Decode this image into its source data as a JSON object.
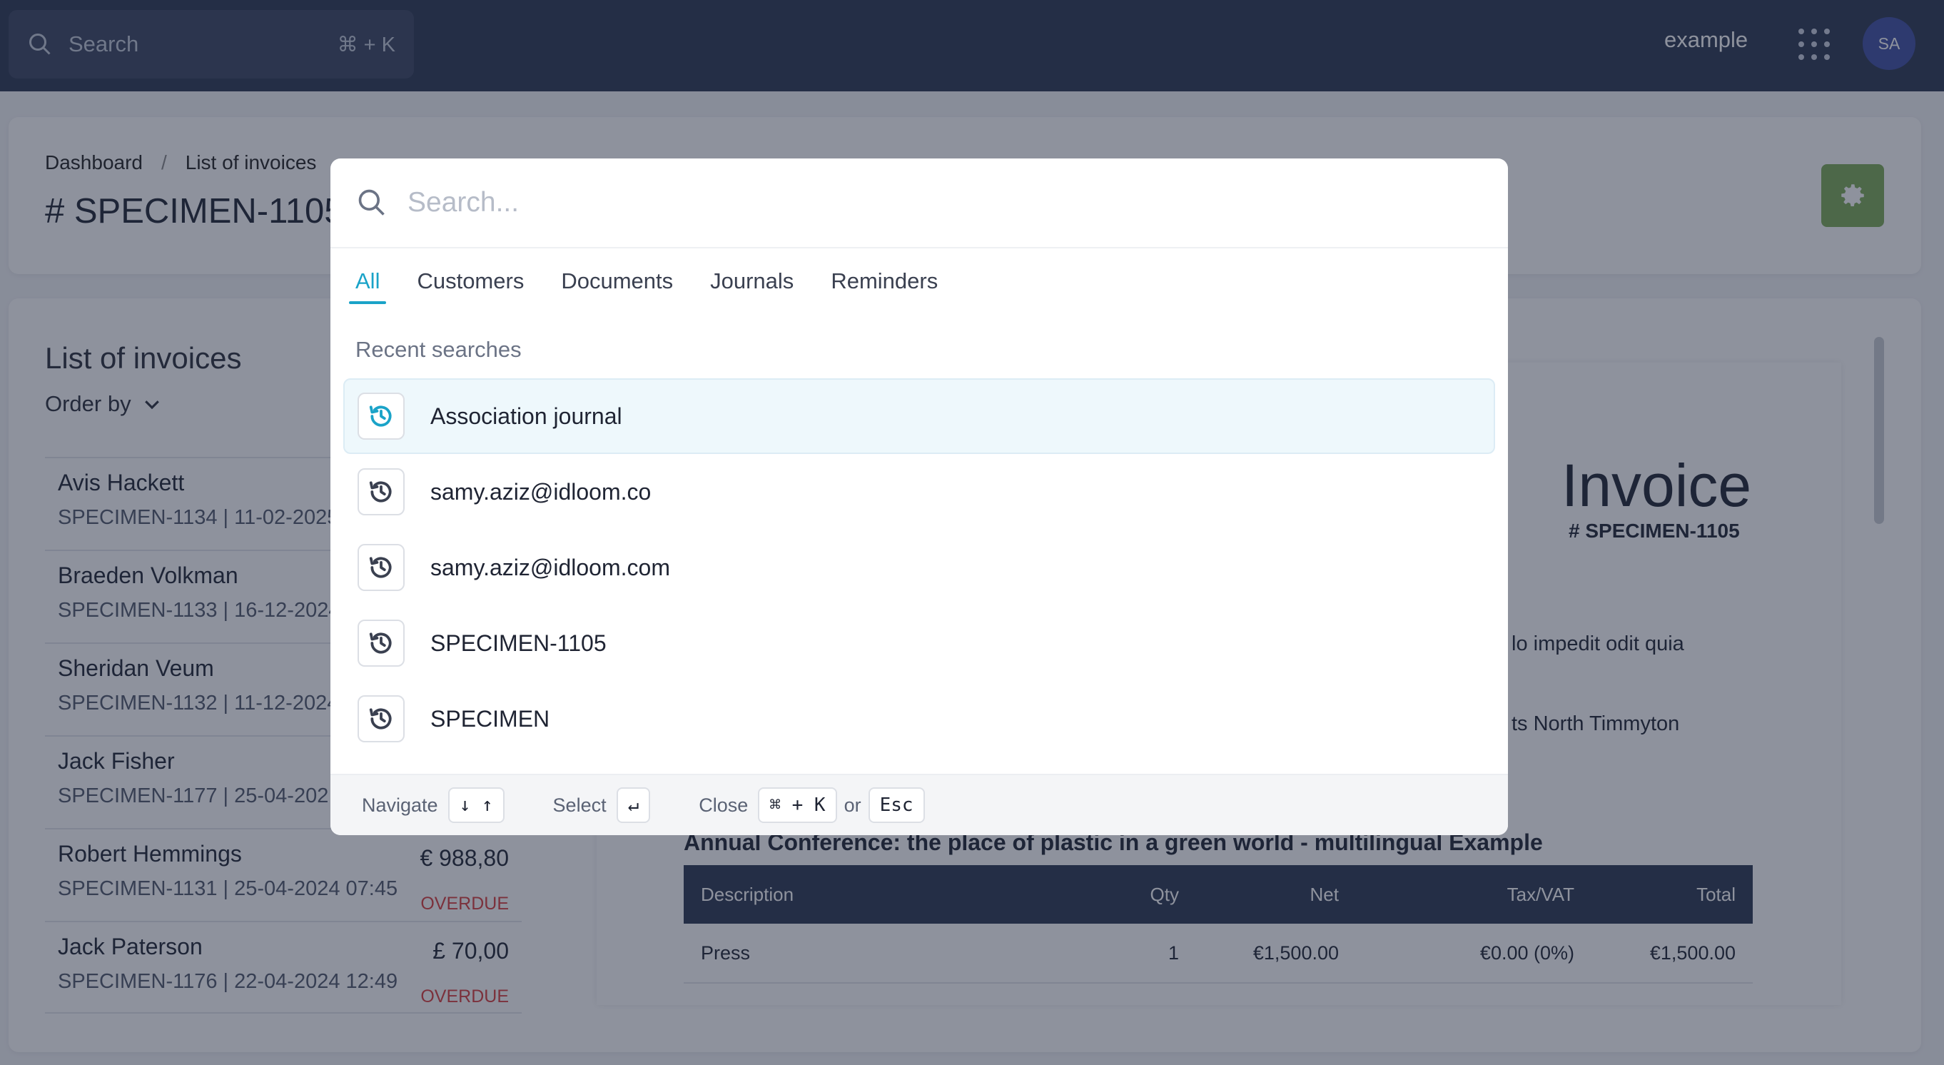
{
  "topbar": {
    "search_placeholder": "Search",
    "shortcut": "⌘ + K",
    "username": "example",
    "avatar_initials": "SA"
  },
  "breadcrumb": {
    "items": [
      "Dashboard",
      "List of invoices"
    ],
    "separator": "/"
  },
  "page": {
    "title": "# SPECIMEN-1105"
  },
  "invoices": {
    "title": "List of invoices",
    "order_by": "Order by",
    "items": [
      {
        "name": "Avis Hackett",
        "meta": "SPECIMEN-1134  |  11-02-2025",
        "amount": "",
        "status": ""
      },
      {
        "name": "Braeden Volkman",
        "meta": "SPECIMEN-1133  |  16-12-2024",
        "amount": "",
        "status": ""
      },
      {
        "name": "Sheridan Veum",
        "meta": "SPECIMEN-1132  |  11-12-2024",
        "amount": "",
        "status": ""
      },
      {
        "name": "Jack Fisher",
        "meta": "SPECIMEN-1177  |  25-04-202",
        "amount": "",
        "status": ""
      },
      {
        "name": "Robert Hemmings",
        "meta": "SPECIMEN-1131  |  25-04-2024 07:45",
        "amount": "€ 988,80",
        "status": "OVERDUE"
      },
      {
        "name": "Jack Paterson",
        "meta": "SPECIMEN-1176  |  22-04-2024 12:49",
        "amount": "£ 70,00",
        "status": "OVERDUE"
      }
    ]
  },
  "preview": {
    "heading": "Invoice",
    "number": "# SPECIMEN-1105",
    "fragment1": "lo impedit odit quia",
    "fragment2": "ts North Timmyton",
    "conference": "Annual Conference: the place of plastic in a green world - multilingual Example",
    "table": {
      "headers": [
        "Description",
        "Qty",
        "Net",
        "Tax/VAT",
        "Total"
      ],
      "rows": [
        [
          "Press",
          "1",
          "€1,500.00",
          "€0.00 (0%)",
          "€1,500.00"
        ]
      ]
    }
  },
  "modal": {
    "search_placeholder": "Search...",
    "tabs": [
      "All",
      "Customers",
      "Documents",
      "Journals",
      "Reminders"
    ],
    "active_tab": "All",
    "recent_title": "Recent searches",
    "recent": [
      "Association journal",
      "samy.aziz@idloom.co",
      "samy.aziz@idloom.com",
      "SPECIMEN-1105",
      "SPECIMEN"
    ],
    "footer": {
      "navigate": "Navigate",
      "navigate_keys": "↓ ↑",
      "select": "Select",
      "select_key": "↵",
      "close": "Close",
      "close_key": "⌘ + K",
      "or": "or",
      "esc": "Esc"
    }
  },
  "colors": {
    "topbar": "#2b3651",
    "accent": "#1aa3c8",
    "settings_button": "#7daa57",
    "overdue": "#d93c3c"
  }
}
